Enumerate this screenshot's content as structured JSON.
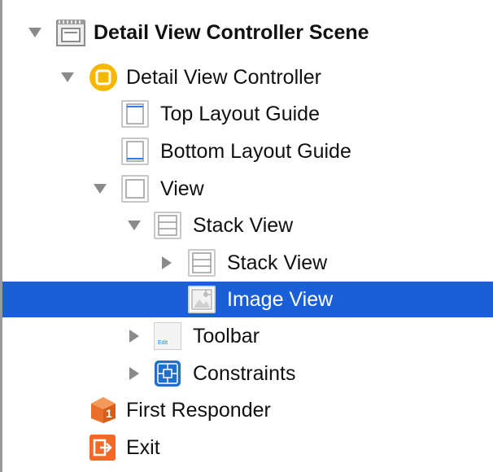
{
  "outline": {
    "scene": {
      "label": "Detail View Controller Scene",
      "icon": "scene-icon"
    },
    "view_controller": {
      "label": "Detail View Controller",
      "icon": "view-controller-icon"
    },
    "top_layout_guide": {
      "label": "Top Layout Guide",
      "icon": "top-layout-guide-icon"
    },
    "bottom_layout_guide": {
      "label": "Bottom Layout Guide",
      "icon": "bottom-layout-guide-icon"
    },
    "view": {
      "label": "View",
      "icon": "view-icon"
    },
    "stack_view_outer": {
      "label": "Stack View",
      "icon": "stack-view-icon"
    },
    "stack_view_inner": {
      "label": "Stack View",
      "icon": "stack-view-icon"
    },
    "image_view": {
      "label": "Image View",
      "icon": "image-view-icon",
      "selected": true
    },
    "toolbar": {
      "label": "Toolbar",
      "icon": "toolbar-icon",
      "icon_text": "Edit"
    },
    "constraints": {
      "label": "Constraints",
      "icon": "constraints-icon"
    },
    "first_responder": {
      "label": "First Responder",
      "icon": "first-responder-icon",
      "icon_text": "1"
    },
    "exit": {
      "label": "Exit",
      "icon": "exit-icon"
    }
  },
  "colors": {
    "selection": "#1a5fd8",
    "view_controller_icon": "#f5b800",
    "constraints_icon": "#1e6fd0",
    "first_responder_icon": "#e8702a",
    "exit_icon": "#ef6a2a",
    "disclosure_arrow": "#8a8a8a"
  }
}
